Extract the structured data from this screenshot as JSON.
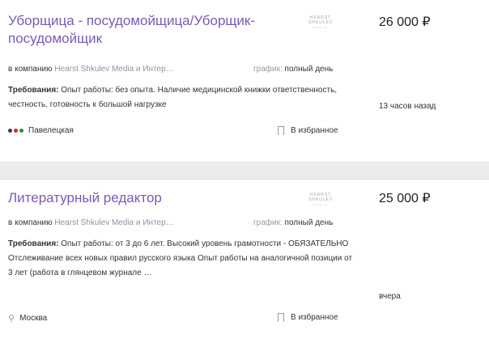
{
  "vacancies": [
    {
      "title": "Уборщица - посудомойщица/Уборщик-посудомойщик",
      "logo": {
        "main": "HEARST SHKULEV",
        "sub": "MEDIA"
      },
      "salary": "26 000 ₽",
      "company_prefix": "в компанию",
      "company_name": "Hearst Shkulev Media и Интер…",
      "schedule_label": "график:",
      "schedule_value": "полный день",
      "req_label": "Требования:",
      "req_text": "Опыт работы: без опыта. Наличие медицинской книжки ответственность, честность, готовность к большой нагрузке",
      "posted": "13 часов назад",
      "location": "Павелецкая",
      "location_icon": "metro-icon",
      "favorite": "В избранное"
    },
    {
      "title": "Литературный редактор",
      "logo": {
        "main": "HEARST SHKULEV",
        "sub": "MEDIA"
      },
      "salary": "25 000 ₽",
      "company_prefix": "в компанию",
      "company_name": "Hearst Shkulev Media и Интер…",
      "schedule_label": "график:",
      "schedule_value": "полный день",
      "req_label": "Требования:",
      "req_text": "Опыт работы: от 3 до 6 лет. Высокий уровень грамотности - ОБЯЗАТЕЛЬНО Отслеживание всех новых правил русского языка Опыт работы на аналогичной позиции от 3 лет (работа в глянцевом журнале …",
      "posted": "вчера",
      "location": "Москва",
      "location_icon": "map-pin-icon",
      "favorite": "В избранное"
    }
  ],
  "colors": {
    "title": "#7a5ab4",
    "metro_dots": [
      "#3a3a3a",
      "#c0392b",
      "#2e8b3d"
    ]
  }
}
